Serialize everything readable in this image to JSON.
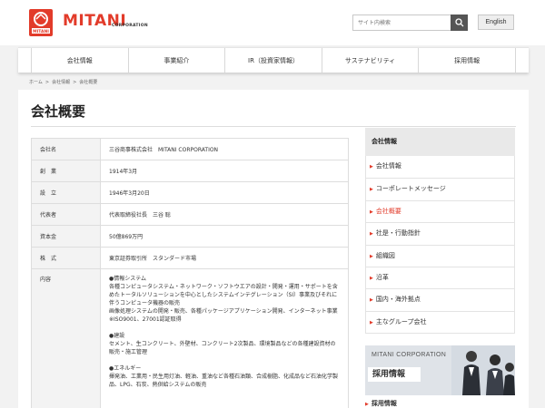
{
  "header": {
    "logo_text": "MITANI",
    "logo_sub": "CORPORATION",
    "search_placeholder": "サイト内検索",
    "lang_label": "English"
  },
  "gnav": [
    "会社情報",
    "事業紹介",
    "IR（投資家情報）",
    "サステナビリティ",
    "採用情報"
  ],
  "breadcrumb": [
    "ホーム",
    "会社情報",
    "会社概要"
  ],
  "page_title": "会社概要",
  "table": {
    "rows": [
      {
        "label": "会社名",
        "value": "三谷商事株式会社　MITANI CORPORATION"
      },
      {
        "label": "創　業",
        "value": "1914年3月"
      },
      {
        "label": "設　立",
        "value": "1946年3月20日"
      },
      {
        "label": "代表者",
        "value": "代表取締役社長　三谷 聡"
      },
      {
        "label": "資本金",
        "value": "50億869万円"
      },
      {
        "label": "株　式",
        "value": "東京証券取引所　スタンダード市場"
      }
    ],
    "business_label": "内容",
    "business_lines": [
      "●情報システム",
      "各種コンピュータシステム・ネットワーク・ソフトウエアの設計・開発・運用・サポートを含めたトータルソリューションを中心としたシステムインテグレーション（SI）事業及びそれに伴うコンピュータ機器の販売",
      "画像処理システムの開発・販売、各種パッケージアプリケーション開発、インターネット事業",
      "※ISO9001、27001認証取得",
      "",
      "●建設",
      "セメント、生コンクリート、外壁材、コンクリート2次製品、環境製品などの各種建設資材の販売・施工管理",
      "",
      "●エネルギー",
      "揮発油、工業用・民生用灯油、軽油、重油など各種石油類、合成樹脂、化成品など石油化学製品、LPG、石炭、熱供給システムの販売"
    ]
  },
  "sidebar": {
    "title": "会社情報",
    "items": [
      {
        "label": "会社情報",
        "active": false
      },
      {
        "label": "コーポレートメッセージ",
        "active": false
      },
      {
        "label": "会社概要",
        "active": true
      },
      {
        "label": "社是・行動指針",
        "active": false
      },
      {
        "label": "組織図",
        "active": false
      },
      {
        "label": "沿革",
        "active": false
      },
      {
        "label": "国内・海外拠点",
        "active": false
      },
      {
        "label": "主なグループ会社",
        "active": false
      }
    ]
  },
  "banner": {
    "corp": "MITANI CORPORATION",
    "tag": "採用情報"
  },
  "recruit_link": "採用情報",
  "colors": {
    "accent": "#e23b2a",
    "page_bg": "#f2f2f2"
  }
}
